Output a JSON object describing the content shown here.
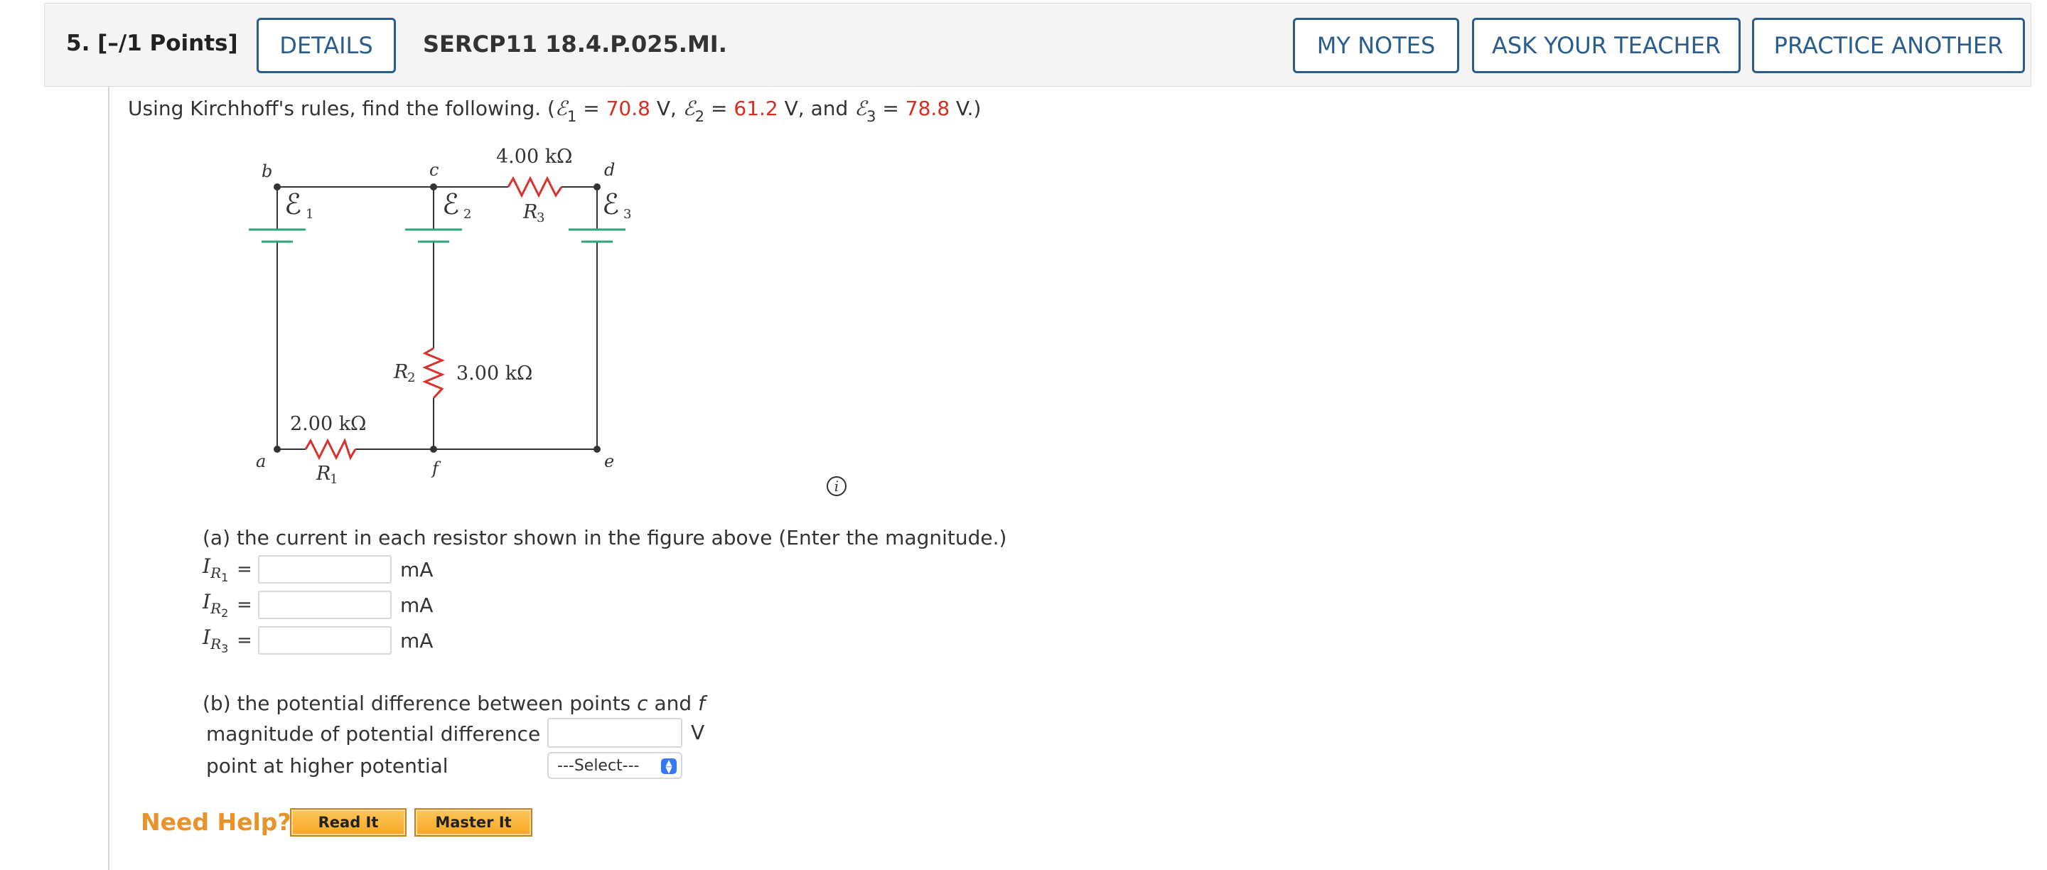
{
  "header": {
    "question_number": "5.",
    "points": "[–/1 Points]",
    "details_label": "DETAILS",
    "problem_code": "SERCP11 18.4.P.025.MI.",
    "my_notes_label": "MY NOTES",
    "ask_teacher_label": "ASK YOUR TEACHER",
    "practice_another_label": "PRACTICE ANOTHER"
  },
  "intro": {
    "text_start": "Using Kirchhoff's rules, find the following. (",
    "e_symbol": "ℰ",
    "e1_sub": "1",
    "e1_value": "70.8",
    "e2_sub": "2",
    "e2_value": "61.2",
    "e3_sub": "3",
    "e3_value": "78.8",
    "unit_v": "V",
    "and_word": "and",
    "close": "V.)"
  },
  "circuit": {
    "point_a": "a",
    "point_b": "b",
    "point_c": "c",
    "point_d": "d",
    "point_e": "e",
    "point_f": "f",
    "emf1_label": "ℰ",
    "emf1_sub": "1",
    "emf2_label": "ℰ",
    "emf2_sub": "2",
    "emf3_label": "ℰ",
    "emf3_sub": "3",
    "r1_label": "R",
    "r1_sub": "1",
    "r1_value": "2.00 kΩ",
    "r2_label": "R",
    "r2_sub": "2",
    "r2_value": "3.00 kΩ",
    "r3_label": "R",
    "r3_sub": "3",
    "r3_value": "4.00 kΩ",
    "wire_color": "#333333",
    "battery_color": "#2fa37a",
    "resistor_color": "#d8322c"
  },
  "info_icon": "i",
  "part_a": {
    "prompt": "(a) the current in each resistor shown in the figure above (Enter the magnitude.)",
    "rows": [
      {
        "label": "I",
        "sub": "R",
        "subsub": "1",
        "eq": "=",
        "value": "",
        "unit": "mA"
      },
      {
        "label": "I",
        "sub": "R",
        "subsub": "2",
        "eq": "=",
        "value": "",
        "unit": "mA"
      },
      {
        "label": "I",
        "sub": "R",
        "subsub": "3",
        "eq": "=",
        "value": "",
        "unit": "mA"
      }
    ]
  },
  "part_b": {
    "prompt_start": "(b) the potential difference between points ",
    "point_c": "c",
    "and_word": " and ",
    "point_f": "f",
    "magnitude_label": "magnitude of potential difference",
    "magnitude_value": "",
    "magnitude_unit": "V",
    "higher_label": "point at higher potential",
    "select_value": "---Select---"
  },
  "help": {
    "need_help": "Need Help?",
    "read_it": "Read It",
    "master_it": "Master It"
  }
}
